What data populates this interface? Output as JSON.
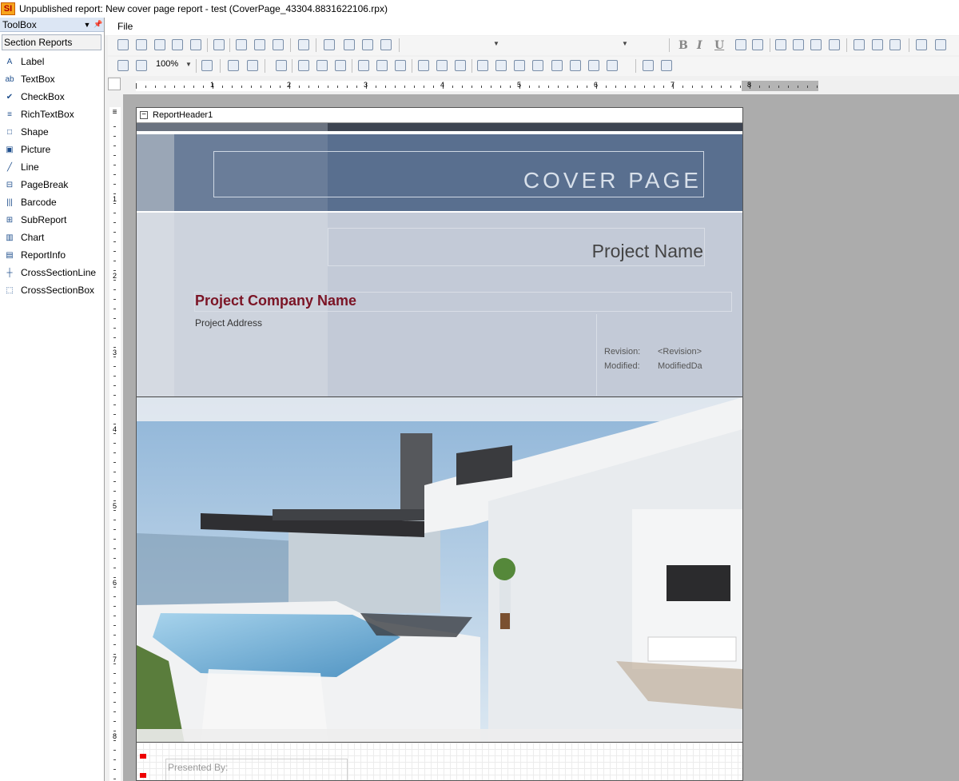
{
  "window": {
    "title": "Unpublished report: New cover page report - test (CoverPage_43304.8831622106.rpx)",
    "app_icon_text": "SI"
  },
  "toolbox": {
    "title": "ToolBox",
    "category_tab": "Section Reports",
    "items": [
      {
        "label": "Label",
        "icon": "label-icon",
        "glyph": "A"
      },
      {
        "label": "TextBox",
        "icon": "textbox-icon",
        "glyph": "ab"
      },
      {
        "label": "CheckBox",
        "icon": "checkbox-icon",
        "glyph": "✔"
      },
      {
        "label": "RichTextBox",
        "icon": "richtextbox-icon",
        "glyph": "≡"
      },
      {
        "label": "Shape",
        "icon": "shape-icon",
        "glyph": "□"
      },
      {
        "label": "Picture",
        "icon": "picture-icon",
        "glyph": "▣"
      },
      {
        "label": "Line",
        "icon": "line-icon",
        "glyph": "╱"
      },
      {
        "label": "PageBreak",
        "icon": "pagebreak-icon",
        "glyph": "⊟"
      },
      {
        "label": "Barcode",
        "icon": "barcode-icon",
        "glyph": "|||"
      },
      {
        "label": "SubReport",
        "icon": "subreport-icon",
        "glyph": "⊞"
      },
      {
        "label": "Chart",
        "icon": "chart-icon",
        "glyph": "▥"
      },
      {
        "label": "ReportInfo",
        "icon": "reportinfo-icon",
        "glyph": "▤"
      },
      {
        "label": "CrossSectionLine",
        "icon": "crosssectionline-icon",
        "glyph": "┼"
      },
      {
        "label": "CrossSectionBox",
        "icon": "crosssectionbox-icon",
        "glyph": "⬚"
      }
    ]
  },
  "menu": {
    "file": "File"
  },
  "toolbar": {
    "zoom_value": "100%"
  },
  "ruler": {
    "horizontal_numbers": [
      "1",
      "2",
      "3",
      "4",
      "5",
      "6",
      "7",
      "8"
    ],
    "vertical_numbers": [
      "1",
      "2",
      "3",
      "4",
      "5",
      "6",
      "7",
      "8"
    ]
  },
  "section": {
    "name": "ReportHeader1"
  },
  "report": {
    "cover_title": "COVER PAGE",
    "project_name": "Project Name",
    "company_name": "Project Company Name",
    "project_address": "Project Address",
    "revision_label": "Revision:",
    "revision_value": "<Revision>",
    "modified_label": "Modified:",
    "modified_value": "ModifiedDa",
    "presented_by": "Presented By:"
  }
}
